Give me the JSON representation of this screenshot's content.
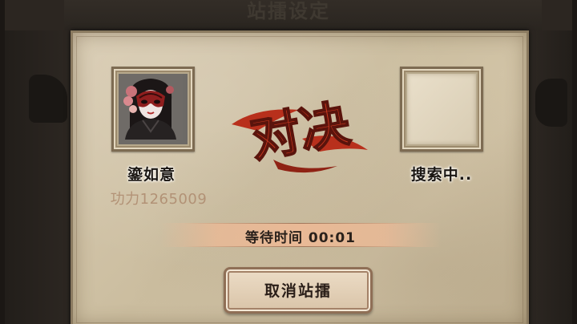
{
  "background": {
    "title": "站擂设定"
  },
  "dialog": {
    "vs_text": "对决",
    "player_left": {
      "name": "鎏如意",
      "power": "功力1265009"
    },
    "player_right": {
      "status": "搜索中.."
    },
    "wait": {
      "label": "等待时间 00:01"
    },
    "cancel_button": "取消站擂"
  },
  "colors": {
    "parchment": "#cfc2a6",
    "vs_red": "#c8321c",
    "power_text": "#b29276",
    "wait_bar": "#e9b996"
  }
}
